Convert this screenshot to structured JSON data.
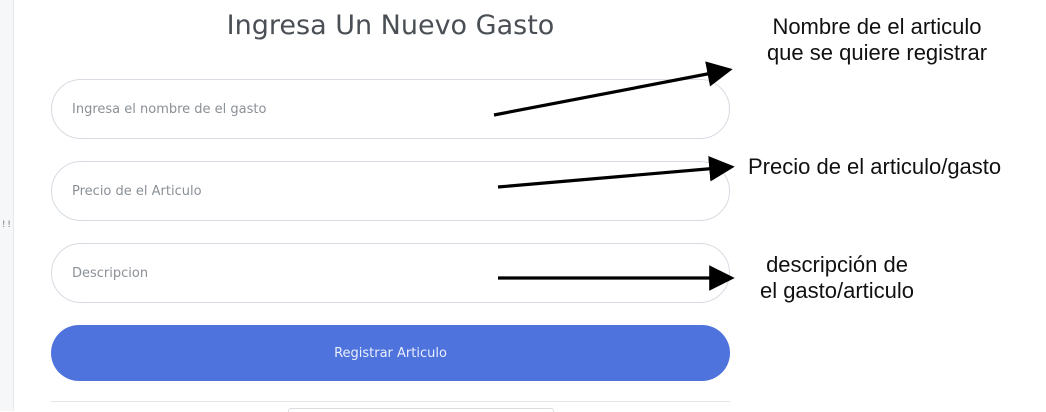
{
  "form": {
    "title": "Ingresa Un Nuevo Gasto",
    "fields": {
      "name_placeholder": "Ingresa el nombre de el gasto",
      "price_placeholder": "Precio de el Articulo",
      "description_placeholder": "Descripcion"
    },
    "submit_label": "Registrar Articulo"
  },
  "annotations": {
    "name": {
      "line1": "Nombre de el articulo",
      "line2": "que se quiere registrar"
    },
    "price": {
      "line1": "Precio de el articulo/gasto"
    },
    "description": {
      "line1": "descripción de",
      "line2": "el gasto/articulo"
    }
  },
  "colors": {
    "button": "#4f73dd",
    "border": "#d7dce2",
    "title": "#4a4f55"
  }
}
